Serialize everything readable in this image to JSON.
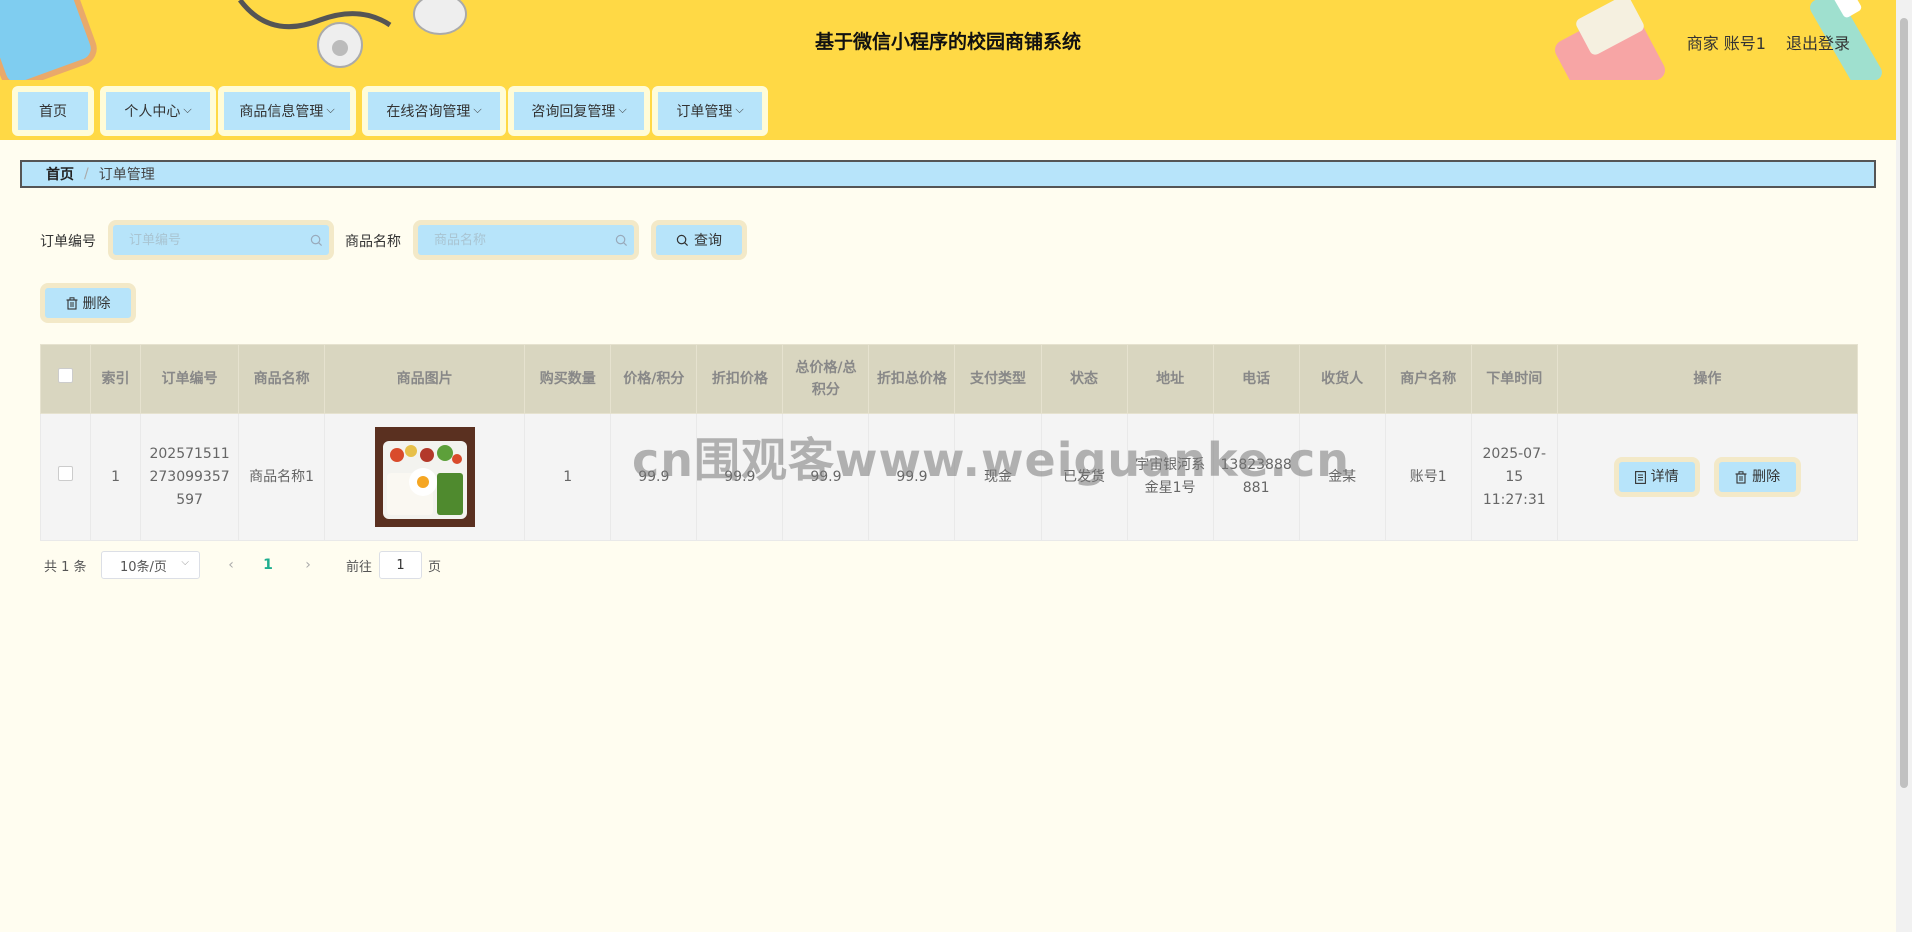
{
  "header": {
    "title": "基于微信小程序的校园商铺系统",
    "user": "商家 账号1",
    "logout": "退出登录"
  },
  "nav": [
    {
      "label": "首页",
      "dropdown": false
    },
    {
      "label": "个人中心",
      "dropdown": true
    },
    {
      "label": "商品信息管理",
      "dropdown": true
    },
    {
      "label": "在线咨询管理",
      "dropdown": true
    },
    {
      "label": "咨询回复管理",
      "dropdown": true
    },
    {
      "label": "订单管理",
      "dropdown": true
    }
  ],
  "breadcrumb": {
    "home": "首页",
    "separator": "/",
    "current": "订单管理"
  },
  "search": {
    "order_no_label": "订单编号",
    "order_no_placeholder": "订单编号",
    "product_label": "商品名称",
    "product_placeholder": "商品名称",
    "query_button": "查询"
  },
  "toolbar": {
    "delete_button": "删除"
  },
  "table": {
    "columns": [
      "索引",
      "订单编号",
      "商品名称",
      "商品图片",
      "购买数量",
      "价格/积分",
      "折扣价格",
      "总价格/总积分",
      "折扣总价格",
      "支付类型",
      "状态",
      "地址",
      "电话",
      "收货人",
      "商户名称",
      "下单时间",
      "操作"
    ],
    "rows": [
      {
        "index": "1",
        "order_no": "202571511273099357597",
        "product": "商品名称1",
        "quantity": "1",
        "price": "99.9",
        "discount_price": "99.9",
        "total": "99.9",
        "discount_total": "99.9",
        "pay_type": "现金",
        "status": "已发货",
        "address": "宇宙银河系金星1号",
        "phone": "13823888881",
        "receiver": "金某",
        "merchant": "账号1",
        "order_time": "2025-07-15 11:27:31",
        "detail_button": "详情",
        "delete_button": "删除"
      }
    ]
  },
  "pagination": {
    "total": "共 1 条",
    "page_size": "10条/页",
    "current_page": "1",
    "goto_label": "前往",
    "goto_value": "1",
    "page_suffix": "页"
  },
  "watermark": "cn围观客www.weiguanke.cn",
  "colors": {
    "header_bg": "#ffd945",
    "button_bg": "#b7e4fa",
    "page_bg": "#fffdf0",
    "active_page": "#1fae8f"
  }
}
